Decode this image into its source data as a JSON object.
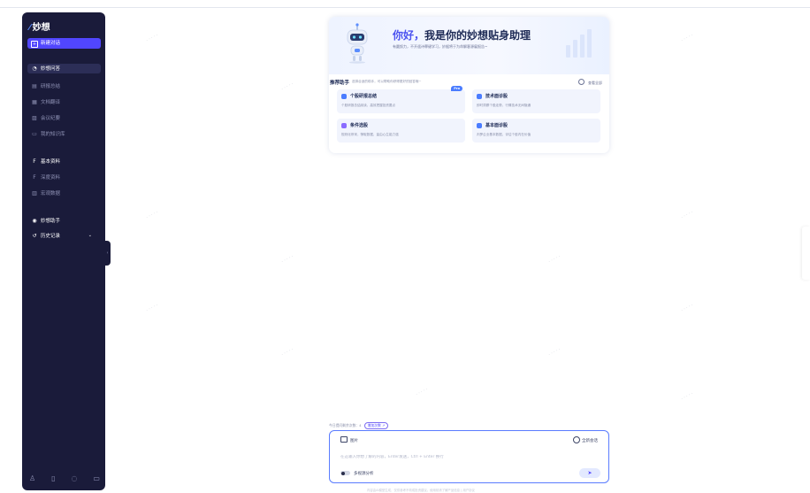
{
  "sidebar": {
    "logo": "妙想",
    "new_chat": "新建对话",
    "items": [
      {
        "label": "妙想问答",
        "icon": "chat-icon"
      },
      {
        "label": "研报总结",
        "icon": "report-icon"
      },
      {
        "label": "文档翻译",
        "icon": "translate-icon"
      },
      {
        "label": "会议纪要",
        "icon": "minutes-icon"
      },
      {
        "label": "我的知识库",
        "icon": "folder-icon"
      },
      {
        "label": "基本资料",
        "icon": "f10-icon"
      },
      {
        "label": "深度资料",
        "icon": "f9-icon"
      },
      {
        "label": "宏观数据",
        "icon": "data-icon"
      },
      {
        "label": "妙想助手",
        "icon": "assistant-icon"
      },
      {
        "label": "历史记录",
        "icon": "history-icon"
      }
    ]
  },
  "hero": {
    "title_prefix": "你好，",
    "title_main": "我是你的妙想贴身助理",
    "subtitle": "有圆努力，不开遥诗罪键学习，妙据将于为命解客源雇报告~"
  },
  "recommend": {
    "title": "推荐助手",
    "note": "选择合适的助手，可以帮助你获得更好的回答哦~",
    "view_all": "查看全部",
    "cards": [
      {
        "title": "个股研报总结",
        "desc": "个股研报总结阅读，高效把握投资要点",
        "badge": "Pro",
        "color": "#4a7cff"
      },
      {
        "title": "技术面诊股",
        "desc": "即时洞察个股走势，行情技术无间隐通",
        "color": "#4a7cff"
      },
      {
        "title": "条件选股",
        "desc": "规则化停采，筛取数据，量由心生能力强",
        "color": "#8a6cff"
      },
      {
        "title": "基本面诊股",
        "desc": "判罗企业基本数据，评估个股内在价值",
        "color": "#4a7cff"
      }
    ]
  },
  "composer": {
    "quota_label": "今日提问剩余次数：4",
    "quota_link": "增加次数 ↗",
    "attach_label": "图片",
    "new_session": "全新会话",
    "placeholder": "在这输入你想了解的内容，Enter发送，Ctrl + Enter 换行",
    "multi_source": "多视源分析",
    "disclaimer": "内容由AI模型生成，仅供参考不构成投资建议。使用前请了解产品信息 | 用户协议"
  },
  "colors": {
    "sidebar_bg": "#1a1b3a",
    "accent": "#5146ff",
    "card_bg": "#f1f4fd"
  }
}
